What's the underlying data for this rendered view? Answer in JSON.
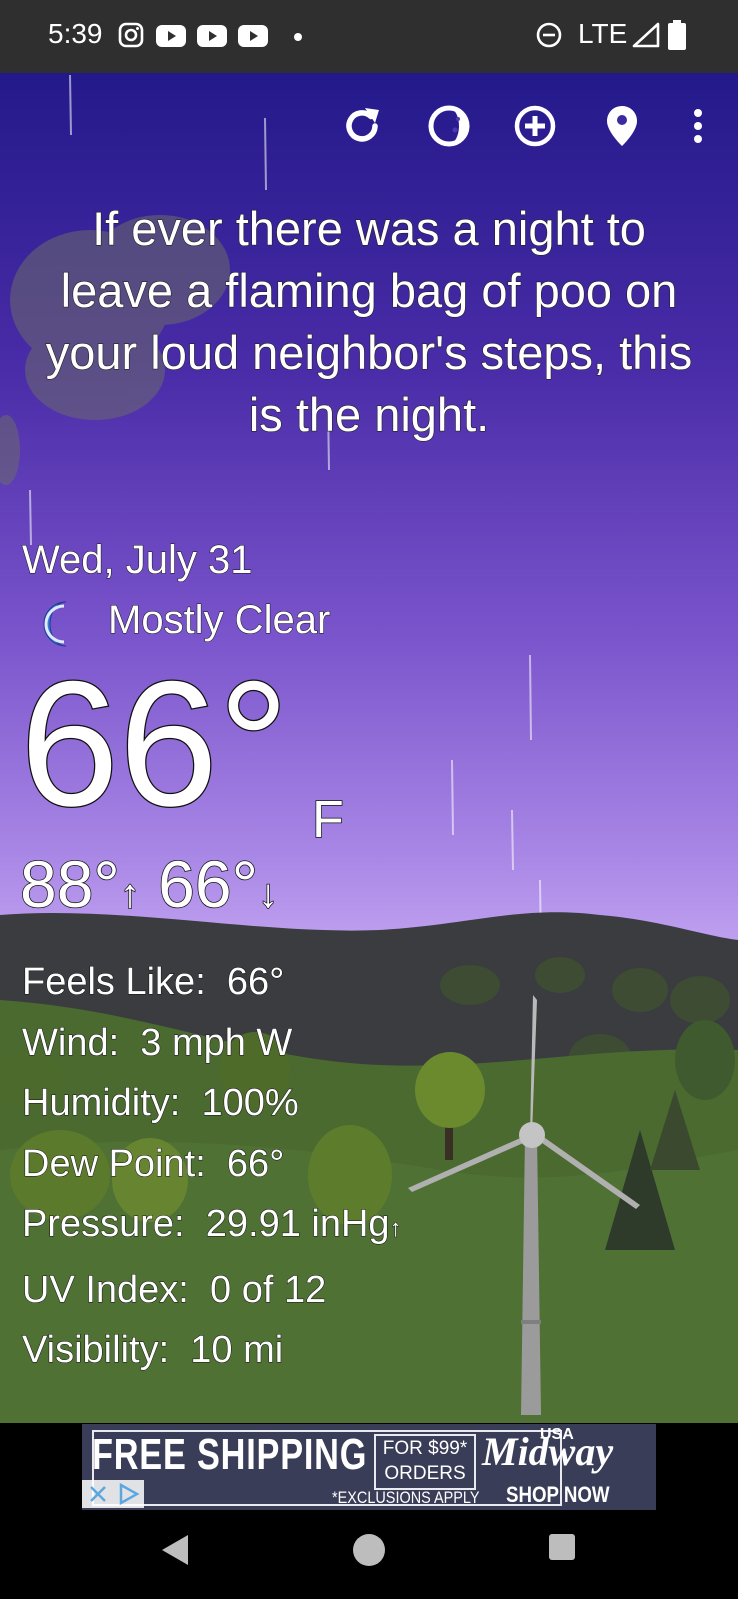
{
  "status_bar": {
    "time": "5:39",
    "network": "LTE",
    "icons": [
      "instagram-icon",
      "youtube-icon",
      "youtube-icon",
      "youtube-icon",
      "dot-icon",
      "dnd-icon",
      "signal-icon",
      "battery-icon"
    ]
  },
  "toolbar": {
    "icons": [
      "refresh-icon",
      "moon-phase-icon",
      "add-location-icon",
      "location-pin-icon",
      "more-vert-icon"
    ]
  },
  "quote": "If ever there was a night to leave a flaming bag of poo on your loud neighbor's steps, this is the night.",
  "weather": {
    "date": "Wed, July 31",
    "condition": "Mostly Clear",
    "condition_icon": "crescent-moon-icon",
    "temperature": "66°",
    "unit": "F",
    "high": "88°",
    "low": "66°",
    "details": [
      {
        "label": "Feels Like:",
        "value": "66°"
      },
      {
        "label": "Wind:",
        "value": "3 mph W"
      },
      {
        "label": "Humidity:",
        "value": "100%"
      },
      {
        "label": "Dew Point:",
        "value": "66°"
      },
      {
        "label": "Pressure:",
        "value": "29.91 inHg"
      },
      {
        "label": "UV Index:",
        "value": "0 of 12"
      },
      {
        "label": "Visibility:",
        "value": "10 mi"
      }
    ]
  },
  "ad": {
    "headline": "FREE SHIPPING",
    "offer_line1": "FOR $99*",
    "offer_line2": "ORDERS",
    "disclaimer": "*EXCLUSIONS APPLY",
    "brand": "Midway",
    "brand_tag": "USA",
    "cta": "SHOP NOW"
  },
  "colors": {
    "sky_top": "#23198a",
    "sky_bottom": "#c9aef3",
    "hill_dark": "#3a3c3f",
    "grass": "#4c6b32",
    "moon_icon": "#3c7be0"
  }
}
